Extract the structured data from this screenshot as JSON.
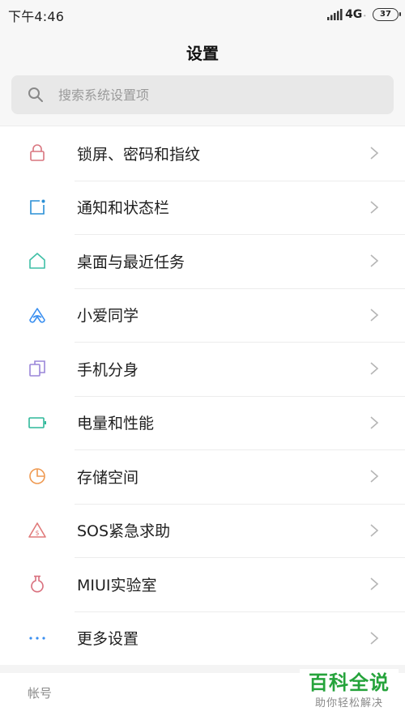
{
  "status_bar": {
    "time": "下午4:46",
    "network": "4G",
    "network_sub": "⁺",
    "battery": "37"
  },
  "header": {
    "title": "设置"
  },
  "search": {
    "placeholder": "搜索系统设置项"
  },
  "settings": {
    "items": [
      {
        "label": "锁屏、密码和指纹",
        "icon": "lock-icon",
        "color": "#d9757f"
      },
      {
        "label": "通知和状态栏",
        "icon": "notification-icon",
        "color": "#2a8fd6"
      },
      {
        "label": "桌面与最近任务",
        "icon": "home-icon",
        "color": "#3fbfa6"
      },
      {
        "label": "小爱同学",
        "icon": "xiaoai-icon",
        "color": "#3a8ff0"
      },
      {
        "label": "手机分身",
        "icon": "second-space-icon",
        "color": "#9a86d8"
      },
      {
        "label": "电量和性能",
        "icon": "battery-icon",
        "color": "#2fb89a"
      },
      {
        "label": "存储空间",
        "icon": "storage-icon",
        "color": "#ef9a52"
      },
      {
        "label": "SOS紧急求助",
        "icon": "sos-icon",
        "color": "#e07a7a"
      },
      {
        "label": "MIUI实验室",
        "icon": "lab-flask-icon",
        "color": "#d9707e"
      },
      {
        "label": "更多设置",
        "icon": "more-dots-icon",
        "color": "#3a8ff0"
      }
    ]
  },
  "account": {
    "header": "帐号"
  },
  "watermark": {
    "main": "百科全说",
    "sub": "助你轻松解决"
  }
}
